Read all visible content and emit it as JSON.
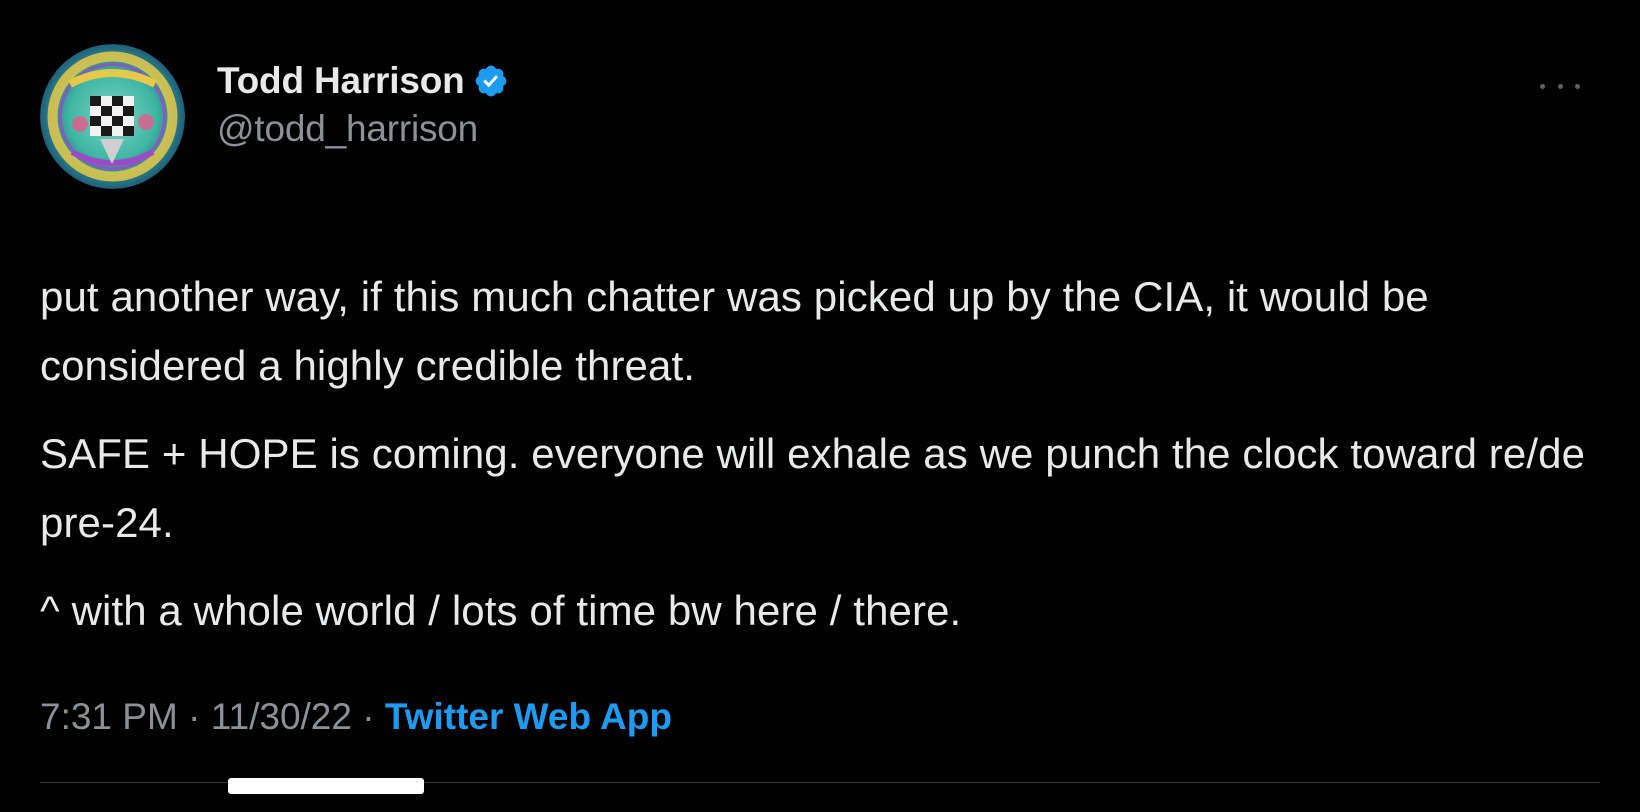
{
  "tweet": {
    "author": {
      "display_name": "Todd Harrison",
      "handle": "@todd_harrison",
      "verified": true
    },
    "paragraphs": [
      "put another way, if this much chatter was picked up by the CIA, it would be considered a highly credible threat.",
      "SAFE + HOPE is coming.  everyone will exhale as we punch the clock toward re/de pre-24.",
      "^ with a whole world / lots of time bw here / there."
    ],
    "meta": {
      "time": "7:31 PM",
      "separator": " · ",
      "date": "11/30/22",
      "source": "Twitter Web App"
    }
  },
  "colors": {
    "background": "#000000",
    "text": "#e7e9ea",
    "secondary": "#8b9197",
    "link": "#1d9bf0",
    "verified_badge": "#1d9bf0"
  },
  "icons": {
    "verified": "verified-badge-icon",
    "more": "more-horizontal-icon"
  }
}
